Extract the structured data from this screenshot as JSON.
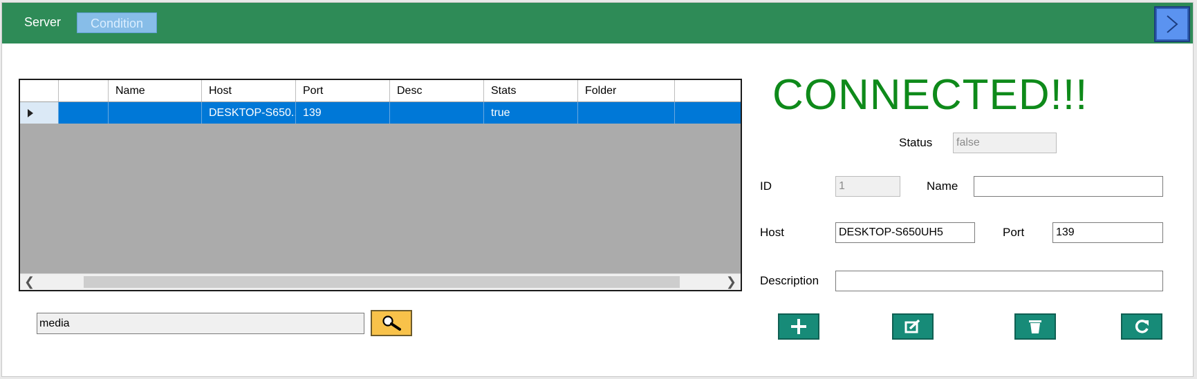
{
  "header": {
    "tab_server": "Server",
    "tab_condition": "Condition",
    "next_icon": "chevron-right-icon"
  },
  "grid": {
    "columns": [
      "",
      "Name",
      "Host",
      "Port",
      "Desc",
      "Stats",
      "Folder"
    ],
    "rows": [
      {
        "cells": [
          "",
          "",
          "DESKTOP-S650...",
          "139",
          "",
          "true",
          ""
        ]
      }
    ]
  },
  "search": {
    "value": "media",
    "icon": "search-icon"
  },
  "status_banner": "CONNECTED!!!",
  "form": {
    "status_label": "Status",
    "status_value": "false",
    "id_label": "ID",
    "id_value": "1",
    "name_label": "Name",
    "name_value": "",
    "host_label": "Host",
    "host_value": "DESKTOP-S650UH5",
    "port_label": "Port",
    "port_value": "139",
    "description_label": "Description",
    "description_value": ""
  },
  "actions": [
    "plus-icon",
    "edit-icon",
    "trash-icon",
    "refresh-icon"
  ],
  "colors": {
    "titlebar": "#2e8b57",
    "connected": "#0e8a1a",
    "selection": "#0078d7",
    "action": "#178b78",
    "search_button": "#f8c24a"
  }
}
